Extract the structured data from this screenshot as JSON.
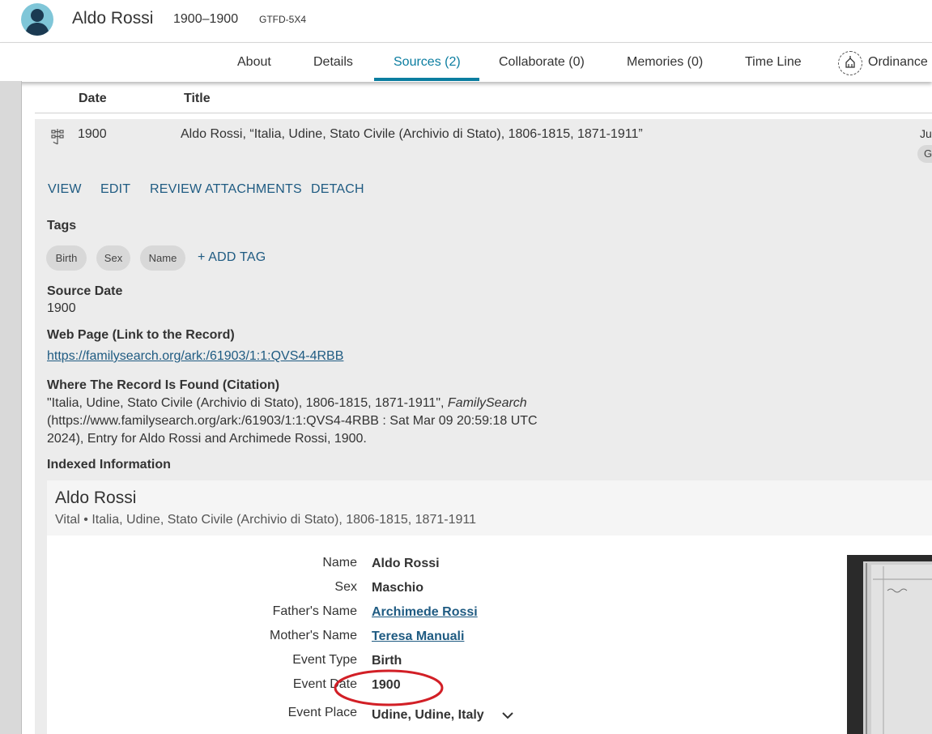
{
  "person": {
    "name": "Aldo Rossi",
    "lifespan": "1900–1900",
    "id": "GTFD-5X4"
  },
  "tabs": [
    {
      "label": "About"
    },
    {
      "label": "Details"
    },
    {
      "label": "Sources (2)",
      "active": true
    },
    {
      "label": "Collaborate (0)"
    },
    {
      "label": "Memories (0)"
    },
    {
      "label": "Time Line"
    },
    {
      "label": "Ordinance"
    }
  ],
  "table": {
    "col_date": "Date",
    "col_title": "Title"
  },
  "source": {
    "date": "1900",
    "title": "Aldo Rossi, “Italia, Udine, Stato Civile (Archivio di Stato), 1806-1815, 1871-1911”",
    "right_cut_text": "Jul",
    "right_cut_badge": "G",
    "actions": {
      "view": "VIEW",
      "edit": "EDIT",
      "review": "REVIEW ATTACHMENTS",
      "detach": "DETACH"
    },
    "tags_label": "Tags",
    "tags": [
      "Birth",
      "Sex",
      "Name"
    ],
    "add_tag": "+ ADD TAG",
    "source_date_label": "Source Date",
    "source_date_value": "1900",
    "web_page_label": "Web Page (Link to the Record)",
    "web_page_url": "https://familysearch.org/ark:/61903/1:1:QVS4-4RBB",
    "citation_label": "Where The Record Is Found (Citation)",
    "citation_line1_a": "\"Italia, Udine, Stato Civile (Archivio di Stato), 1806-1815, 1871-1911\", ",
    "citation_line1_b": "FamilySearch",
    "citation_line2": "(https://www.familysearch.org/ark:/61903/1:1:QVS4-4RBB : Sat Mar 09 20:59:18 UTC",
    "citation_line3": "2024), Entry for Aldo Rossi and Archimede Rossi, 1900.",
    "indexed_label": "Indexed Information"
  },
  "indexed": {
    "name": "Aldo Rossi",
    "subtitle": "Vital • Italia, Udine, Stato Civile (Archivio di Stato), 1806-1815, 1871-1911",
    "rows": [
      {
        "label": "Name",
        "value": "Aldo Rossi"
      },
      {
        "label": "Sex",
        "value": "Maschio"
      },
      {
        "label": "Father's Name",
        "value": "Archimede Rossi",
        "link": true
      },
      {
        "label": "Mother's Name",
        "value": "Teresa Manuali",
        "link": true
      },
      {
        "label": "Event Type",
        "value": "Birth"
      },
      {
        "label": "Event Date",
        "value": "1900"
      },
      {
        "label": "Event Place",
        "value": "Udine, Udine, Italy"
      }
    ]
  },
  "colors": {
    "accent": "#0b7da0",
    "link": "#1f5b82",
    "highlight_circle": "#d21f26",
    "panel": "#ececec"
  },
  "icons": [
    "person-avatar-icon",
    "tree-icon",
    "temple-icon",
    "chevron-down-icon"
  ]
}
